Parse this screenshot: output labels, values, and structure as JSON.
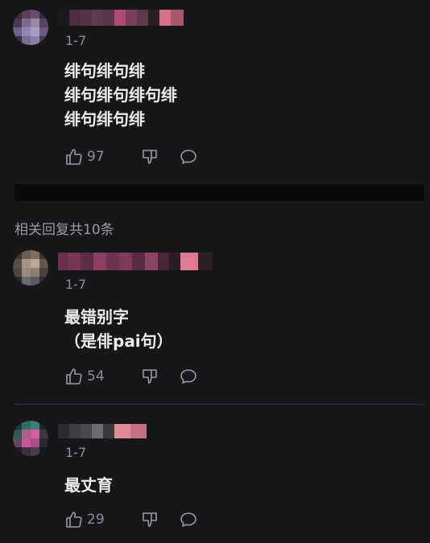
{
  "comments": [
    {
      "date": "1-7",
      "text": "绯句绯句绯\n绯句绯句绯句绯\n绯句绯句绯",
      "likes": "97"
    },
    {
      "date": "1-7",
      "text": "最错别字\n（是俳pai句）",
      "likes": "54"
    },
    {
      "date": "1-7",
      "text": "最丈育",
      "likes": "29"
    }
  ],
  "replies_header": "相关回复共10条",
  "colors": {
    "background": "#161719",
    "text": "#ededed",
    "muted": "#8d8e91",
    "divider": "#0a0a0b"
  },
  "icons": [
    "thumbs-up-icon",
    "thumbs-down-icon",
    "reply-bubble-icon"
  ]
}
